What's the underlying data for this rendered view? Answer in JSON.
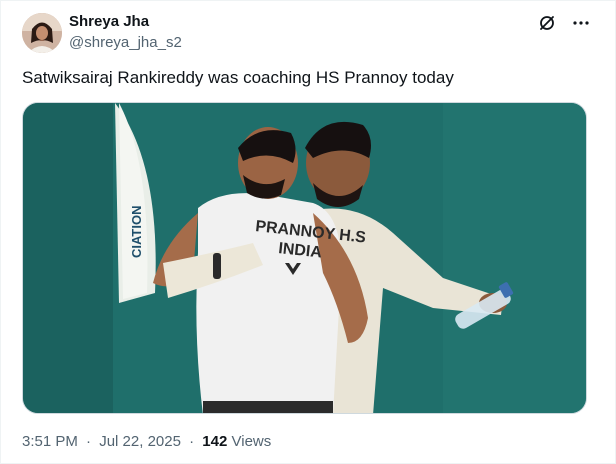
{
  "author": {
    "display_name": "Shreya Jha",
    "handle": "@shreya_jha_s2"
  },
  "tweet": {
    "text": "Satwiksairaj Rankireddy was coaching HS Prannoy today"
  },
  "media": {
    "jersey_line1": "PRANNOY H.S",
    "jersey_line2": "INDIA",
    "banner_text": "CIATION"
  },
  "meta": {
    "time": "3:51 PM",
    "separator1": "·",
    "date": "Jul 22, 2025",
    "separator2": "·",
    "views_count": "142",
    "views_label": "Views"
  },
  "icons": {
    "grok": "grok-icon",
    "more": "more-icon"
  },
  "colors": {
    "background": "#ffffff",
    "text_primary": "#0f1419",
    "text_secondary": "#536471",
    "border": "#cfd9de",
    "court_teal": "#1f6f6b"
  }
}
